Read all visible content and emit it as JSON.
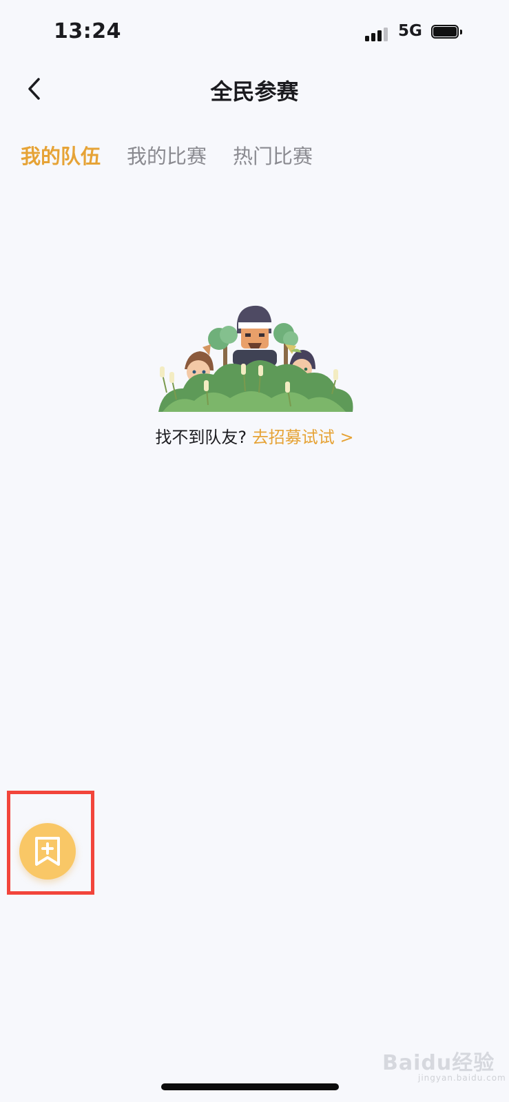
{
  "status_bar": {
    "time": "13:24",
    "network": "5G",
    "icons": [
      "signal-icon",
      "battery-icon"
    ]
  },
  "header": {
    "title": "全民参赛",
    "back_icon": "chevron-left-icon"
  },
  "tabs": [
    {
      "label": "我的队伍",
      "active": true
    },
    {
      "label": "我的比赛",
      "active": false
    },
    {
      "label": "热门比赛",
      "active": false
    }
  ],
  "empty_state": {
    "illustration": "team-characters-in-bushes-illustration",
    "text": "找不到队友?",
    "link_text": "去招募试试 >"
  },
  "fab": {
    "icon": "add-banner-icon",
    "highlight_color": "#f2453b",
    "color": "#f9c766"
  },
  "colors": {
    "accent": "#e6a336",
    "background": "#f7f8fc"
  },
  "watermark": {
    "text": "Baidu经验",
    "url": "jingyan.baidu.com"
  }
}
